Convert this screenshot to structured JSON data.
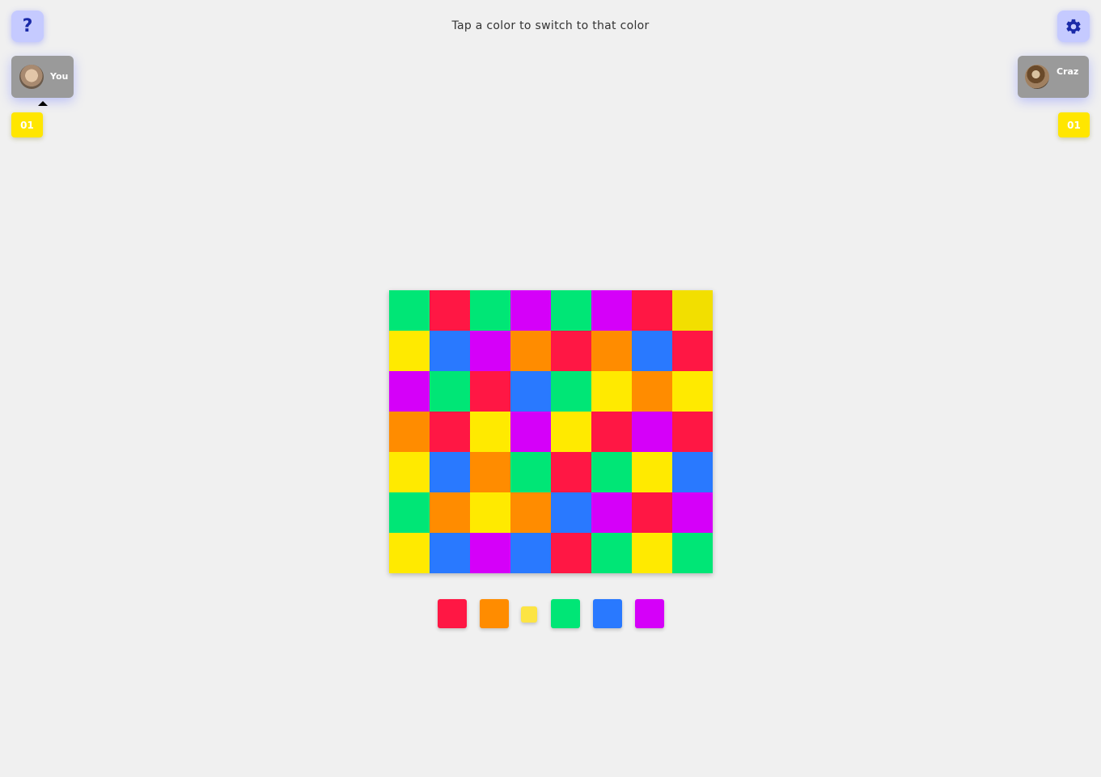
{
  "header": {
    "instruction": "Tap a color to switch to that color",
    "help_icon": "question-mark-icon",
    "help_label": "?",
    "settings_icon": "gear-icon"
  },
  "players": [
    {
      "name": "You",
      "score": "01",
      "active": true
    },
    {
      "name": "Craz",
      "score": "01",
      "active": false
    }
  ],
  "colors": {
    "red": "#ff1744",
    "orange": "#ff8c00",
    "yellow": "#ffea00",
    "green": "#00e676",
    "blue": "#2979ff",
    "purple": "#d500f9",
    "owned_yellow": "#f2df00"
  },
  "board": {
    "rows": 7,
    "cols": 8,
    "cells": [
      [
        "green",
        "red",
        "green",
        "purple",
        "green",
        "purple",
        "red",
        "owned_yellow"
      ],
      [
        "yellow",
        "blue",
        "purple",
        "orange",
        "red",
        "orange",
        "blue",
        "red"
      ],
      [
        "purple",
        "green",
        "red",
        "blue",
        "green",
        "yellow",
        "orange",
        "yellow"
      ],
      [
        "orange",
        "red",
        "yellow",
        "purple",
        "yellow",
        "red",
        "purple",
        "red"
      ],
      [
        "yellow",
        "blue",
        "orange",
        "green",
        "red",
        "green",
        "yellow",
        "blue"
      ],
      [
        "green",
        "orange",
        "yellow",
        "orange",
        "blue",
        "purple",
        "red",
        "purple"
      ],
      [
        "yellow",
        "blue",
        "purple",
        "blue",
        "red",
        "green",
        "yellow",
        "green"
      ]
    ]
  },
  "palette": {
    "options": [
      "red",
      "orange",
      "yellow",
      "green",
      "blue",
      "purple"
    ],
    "selected": "yellow"
  }
}
